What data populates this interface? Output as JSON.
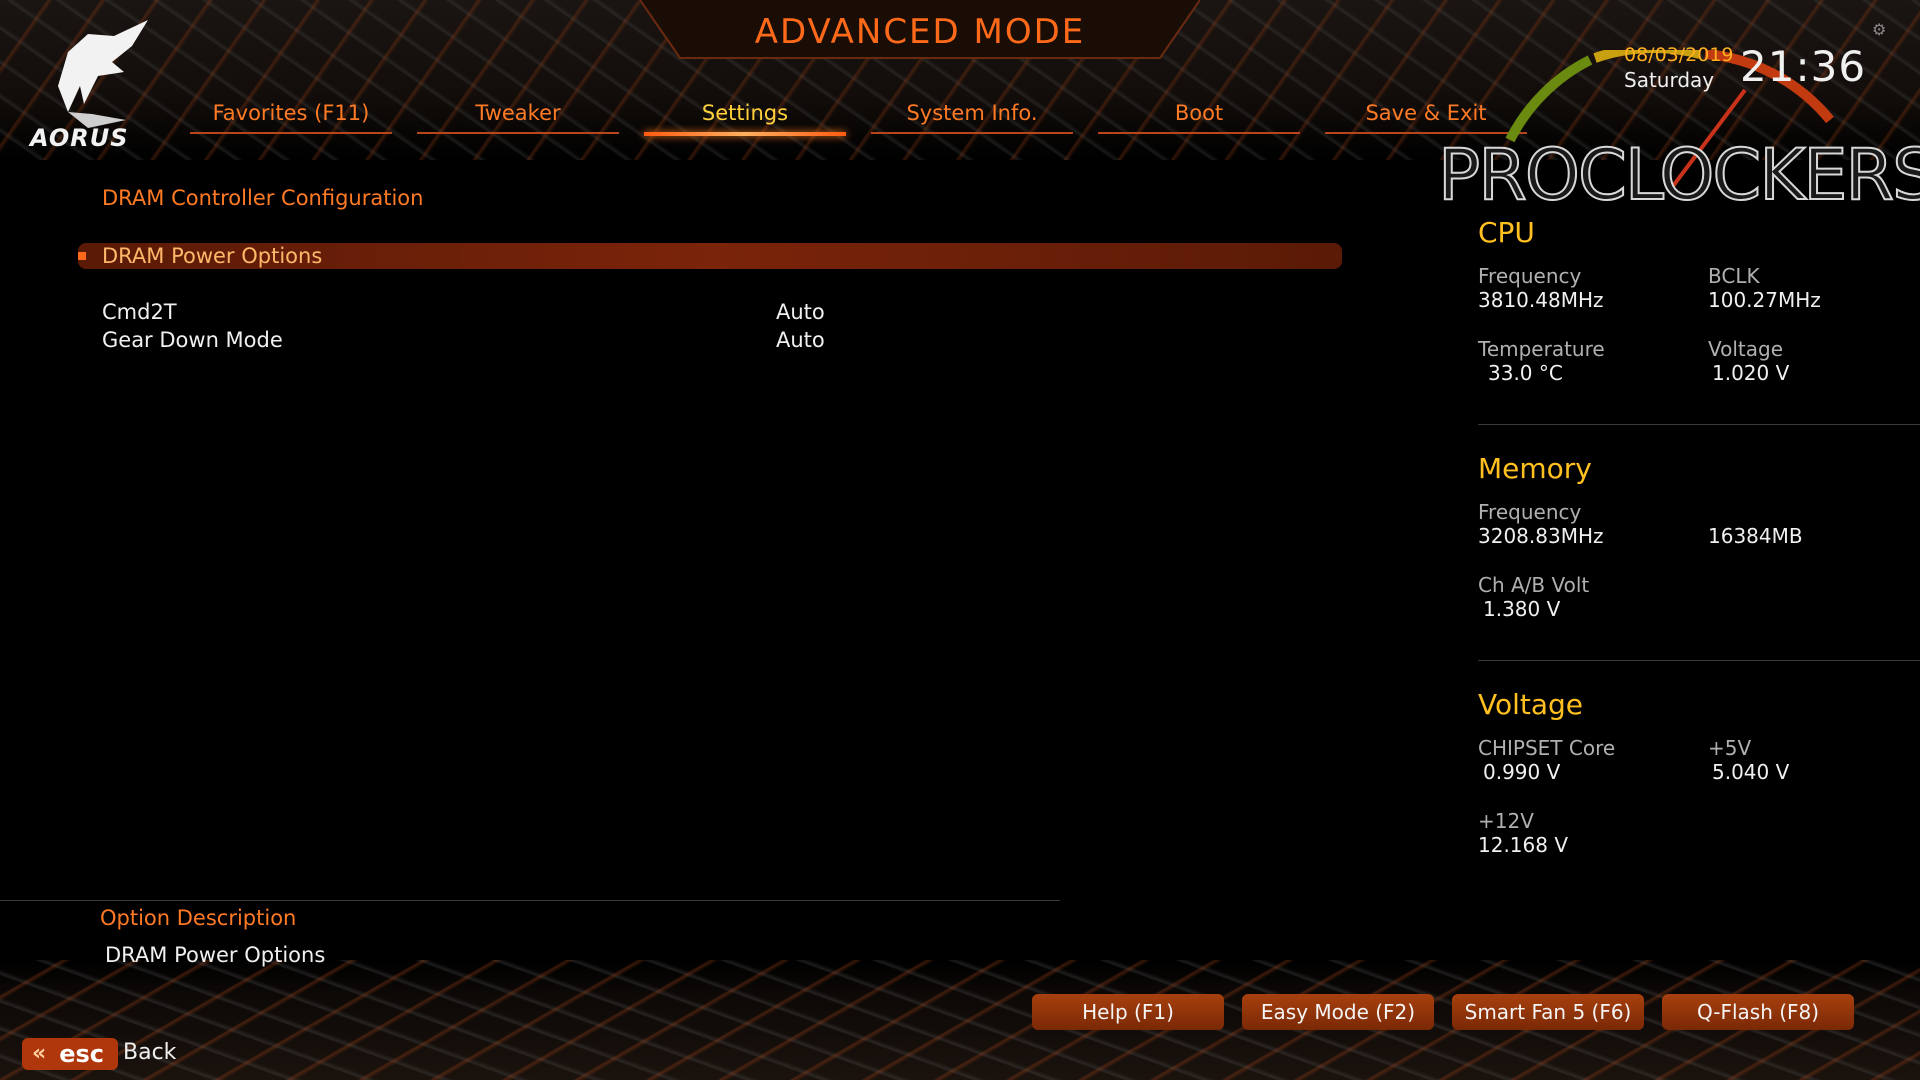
{
  "header": {
    "title": "ADVANCED MODE",
    "brand": "AORUS",
    "date": "08/03/2019",
    "day": "Saturday",
    "time": "21:36",
    "watermark": "PROCLOCKERS"
  },
  "tabs": [
    {
      "label": "Favorites (F11)",
      "active": false
    },
    {
      "label": "Tweaker",
      "active": false
    },
    {
      "label": "Settings",
      "active": true
    },
    {
      "label": "System Info.",
      "active": false
    },
    {
      "label": "Boot",
      "active": false
    },
    {
      "label": "Save & Exit",
      "active": false
    }
  ],
  "main": {
    "breadcrumb": "DRAM Controller Configuration",
    "selected": "DRAM Power Options",
    "options": [
      {
        "label": "Cmd2T",
        "value": "Auto"
      },
      {
        "label": "Gear Down Mode",
        "value": "Auto"
      }
    ]
  },
  "description": {
    "title": "Option Description",
    "text": "DRAM Power Options"
  },
  "cpu": {
    "title": "CPU",
    "frequency_label": "Frequency",
    "frequency": "3810.48MHz",
    "bclk_label": "BCLK",
    "bclk": "100.27MHz",
    "temperature_label": "Temperature",
    "temperature": "33.0 °C",
    "voltage_label": "Voltage",
    "voltage": "1.020 V"
  },
  "memory": {
    "title": "Memory",
    "frequency_label": "Frequency",
    "frequency": "3208.83MHz",
    "size": "16384MB",
    "volt_label": "Ch A/B Volt",
    "volt": "1.380 V"
  },
  "voltage": {
    "title": "Voltage",
    "chipset_label": "CHIPSET Core",
    "chipset": "0.990 V",
    "v5_label": "+5V",
    "v5": "5.040 V",
    "v12_label": "+12V",
    "v12": "12.168 V"
  },
  "footer": {
    "help": "Help (F1)",
    "easy": "Easy Mode (F2)",
    "smartfan": "Smart Fan 5 (F6)",
    "qflash": "Q-Flash (F8)",
    "esc": "esc",
    "back": "Back"
  },
  "colors": {
    "accent": "#ff7a24",
    "highlight": "#ffc020",
    "selected_bg": "#7a240a"
  }
}
